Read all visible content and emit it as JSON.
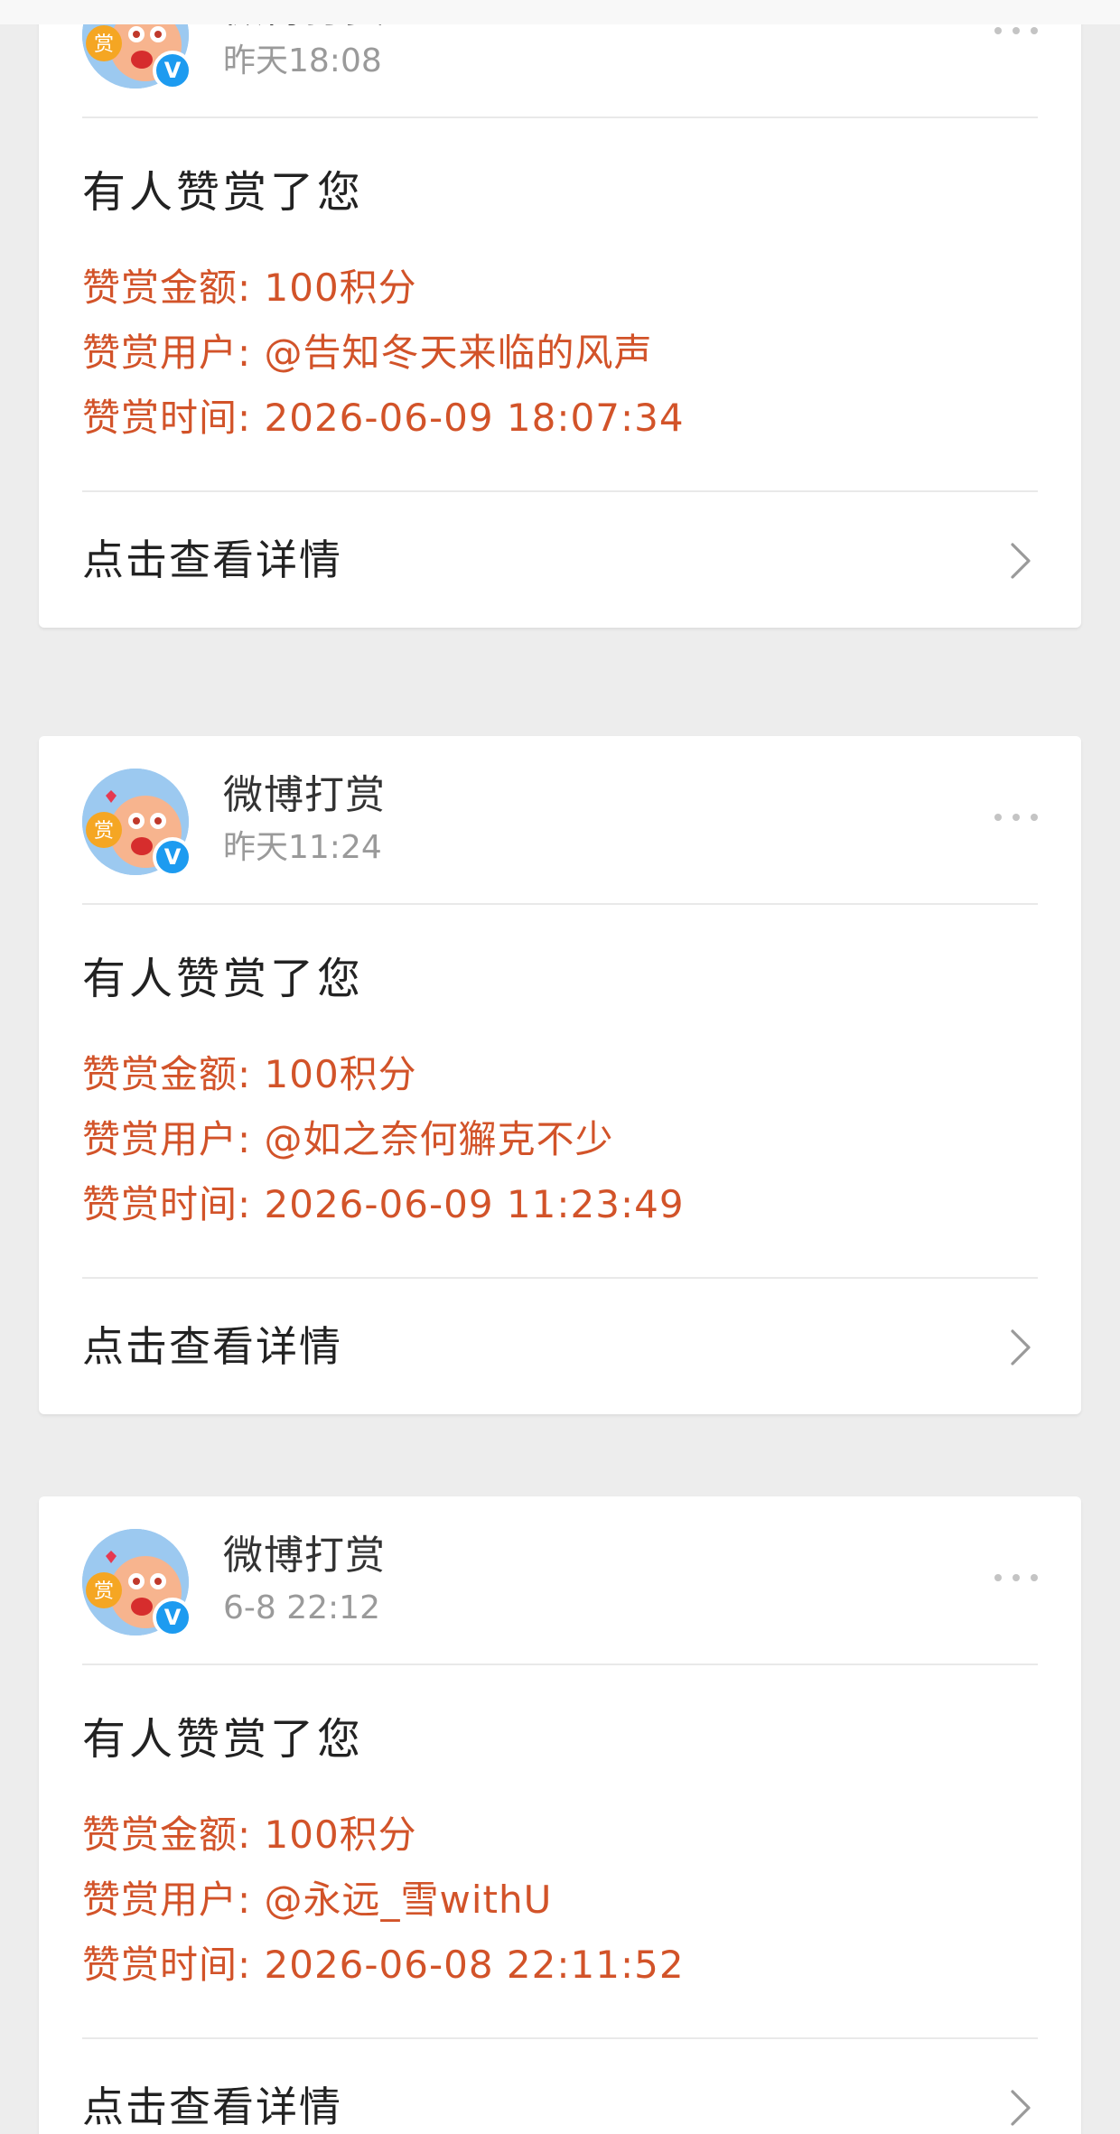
{
  "cards": [
    {
      "sender": {
        "name": "微博打赏",
        "time": "昨天18:08",
        "avatar_label": "赏",
        "verified_label": "V"
      },
      "title": "有人赞赏了您",
      "lines": {
        "amount": "赞赏金额: 100积分",
        "user": "赞赏用户: @告知冬天来临的风声",
        "time": "赞赏时间: 2026-06-09 18:07:34"
      },
      "footer_label": "点击查看详情"
    },
    {
      "sender": {
        "name": "微博打赏",
        "time": "昨天11:24",
        "avatar_label": "赏",
        "verified_label": "V"
      },
      "title": "有人赞赏了您",
      "lines": {
        "amount": "赞赏金额: 100积分",
        "user": "赞赏用户: @如之奈何獬克不少",
        "time": "赞赏时间: 2026-06-09 11:23:49"
      },
      "footer_label": "点击查看详情"
    },
    {
      "sender": {
        "name": "微博打赏",
        "time": "6-8 22:12",
        "avatar_label": "赏",
        "verified_label": "V"
      },
      "title": "有人赞赏了您",
      "lines": {
        "amount": "赞赏金额: 100积分",
        "user": "赞赏用户: @永远_雪withU",
        "time": "赞赏时间: 2026-06-08 22:11:52"
      },
      "footer_label": "点击查看详情"
    }
  ],
  "icons": {
    "more": "more-dots-icon",
    "chevron": "chevron-right-icon",
    "verified": "verified-badge-icon"
  },
  "colors": {
    "background": "#ededed",
    "card": "#ffffff",
    "accent_red": "#d25329",
    "verified_blue": "#1d9bf0"
  }
}
